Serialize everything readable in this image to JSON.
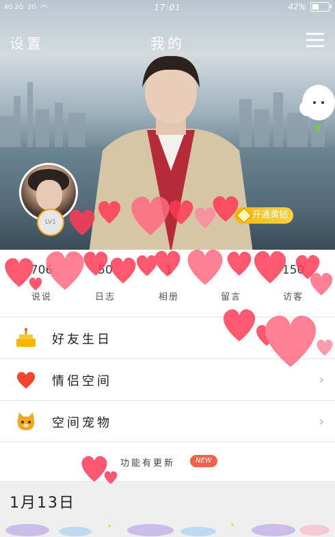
{
  "status_bar": {
    "signal_left": "4G 2G",
    "signal_right": "2G",
    "time": "17:01",
    "battery": "42%"
  },
  "nav": {
    "settings": "设置",
    "title": "我的",
    "menu_icon": "hamburger-menu-icon"
  },
  "profile": {
    "level_badge": "LV1",
    "open_yellow_diamond": "开通黄钻"
  },
  "stats": [
    {
      "num": "706",
      "label": "说说"
    },
    {
      "num": "50",
      "label": "日志"
    },
    {
      "num": "1",
      "label": "相册"
    },
    {
      "num": "",
      "label": "留言"
    },
    {
      "num": "150",
      "label": "访客"
    }
  ],
  "list": [
    {
      "label": "好友生日",
      "icon": "cake-icon"
    },
    {
      "label": "情侣空间",
      "icon": "heart-icon"
    },
    {
      "label": "空间宠物",
      "icon": "pet-cat-icon"
    }
  ],
  "update": {
    "text": "功能有更新",
    "badge": "NEW"
  },
  "date": "1月13日",
  "colors": {
    "accent": "#f2624c",
    "gold": "#f5b700",
    "heart": "#ff3a55"
  }
}
